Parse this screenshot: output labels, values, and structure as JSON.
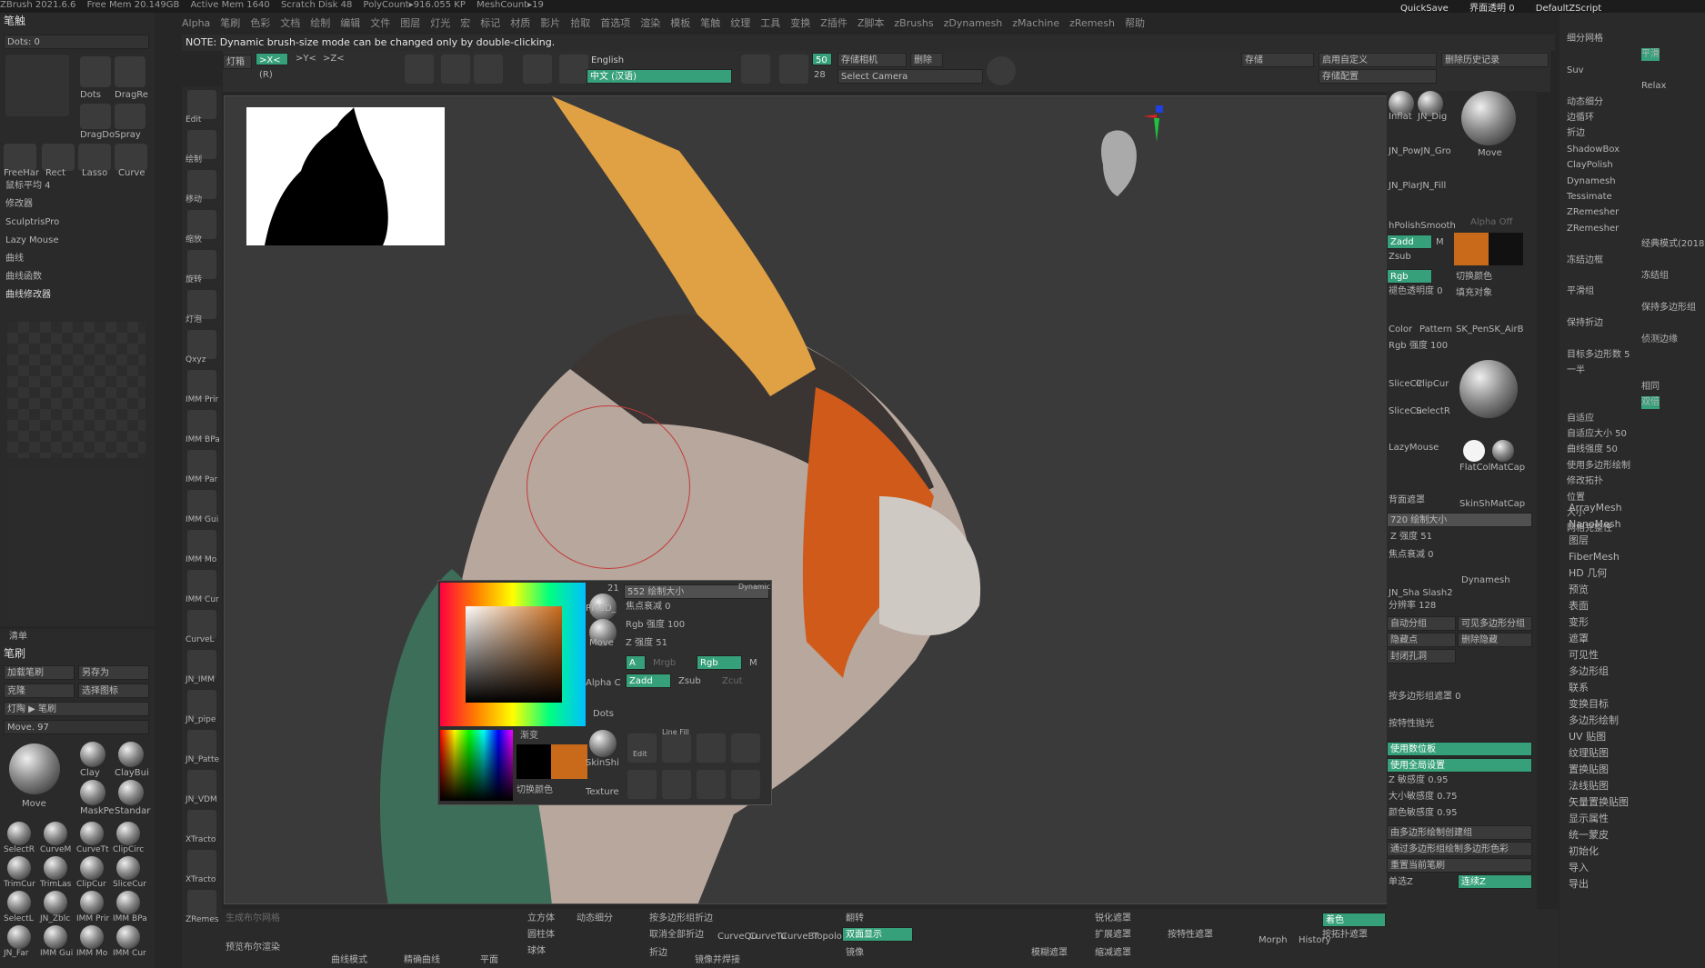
{
  "top_status": [
    "ZBrush 2021.6.6",
    "Free Mem 20.149GB",
    "Active Mem 1640",
    "Scratch Disk 48",
    "PolyCount▸916.055 KP",
    "MeshCount▸19"
  ],
  "top_right": [
    "QuickSave",
    "界面透明 0",
    "DefaultZScript"
  ],
  "menus": [
    "Alpha",
    "笔刷",
    "色彩",
    "文档",
    "绘制",
    "编辑",
    "文件",
    "图层",
    "灯光",
    "宏",
    "标记",
    "材质",
    "影片",
    "拾取",
    "首选项",
    "渲染",
    "模板",
    "笔触",
    "纹理",
    "工具",
    "变换",
    "Z插件",
    "Z脚本",
    "zBrushs",
    "zDynamesh",
    "zMachine",
    "zRemesh",
    "帮助"
  ],
  "note": "NOTE: Dynamic brush-size mode can be changed only by double-clicking.",
  "left_panel": {
    "title": "笔触",
    "dots": "Dots: 0",
    "r": "R",
    "strokes": [
      "Dots",
      "DragRe",
      "DragDo",
      "Spray",
      "FreeHar",
      "Rect",
      "Lasso",
      "Curve"
    ],
    "labels": [
      "鼠标平均 4",
      "修改器",
      "SculptrisPro",
      "Lazy Mouse",
      "曲线",
      "曲线函数",
      "曲线修改器"
    ],
    "bottom": [
      "清单",
      "笔刷"
    ],
    "brush_buttons": [
      "加载笔刷",
      "另存为",
      "克隆",
      "选择图标",
      "灯陶 ▶ 笔刷"
    ],
    "move": "Move. 97",
    "brushes": [
      "Move",
      "Clay",
      "ClayBui",
      "MaskPe",
      "Standar",
      "SelectR",
      "CurveM",
      "CurveTt",
      "ClipCirc",
      "TrimCur",
      "TrimLas",
      "ClipCur",
      "SliceCur",
      "SelectL",
      "JN_Zblc",
      "IMM Prir",
      "IMM BPa",
      "JN_Far",
      "IMM Gui",
      "IMM Mo",
      "IMM Cur"
    ]
  },
  "shelf": {
    "labels": [
      "Edit",
      "绘制",
      "移动",
      "缩放",
      "旋转",
      "灯泡",
      "Qxyz",
      "IMM Prir",
      "IMM BPa",
      "IMM Par",
      "IMM Gui",
      "IMM Mo",
      "IMM Cur",
      "CurveL",
      "JN_IMM",
      "JN_pipe",
      "JN_Patte",
      "JN_VDM",
      "XTracto",
      "XTracto",
      "ZRemes"
    ]
  },
  "toolbar": {
    "xyz": [
      ">X<",
      ">Y<",
      ">Z<"
    ],
    "r": "(R)",
    "light": "灯箱",
    "english": "English",
    "chinese": "中文 (汉语)",
    "fps": "50",
    "num28": "28",
    "cam": "存储相机",
    "del": "删除",
    "select_cam": "Select Camera",
    "store": "存储",
    "custom": "启用自定义",
    "store_cfg": "存储配置",
    "clear_history": "删除历史记录"
  },
  "popup": {
    "size": "552 绘制大小",
    "focal": "焦点衰减 0",
    "rgb": "Rgb 强度 100",
    "z": "Z 强度 51",
    "a": "A",
    "mrgb": "Mrgb",
    "rgb2": "Rgb",
    "m": "M",
    "zadd": "Zadd",
    "zsub": "Zsub",
    "zcut": "Zcut",
    "gradient": "渐变",
    "switch": "切换颜色",
    "num21": "21",
    "pm": "PM3D_",
    "move": "Move",
    "alpha": "Alpha C",
    "dots": "Dots",
    "skin": "SkinShi",
    "texture": "Texture",
    "edit": "Edit",
    "linefill": "Line Fill",
    "dynamic": "Dynamic"
  },
  "right_panel": {
    "brushes": [
      "Inflat",
      "JN_Dig",
      "JN_PowJN_Gro",
      "JN_PlarJN_Fill",
      "hPolishSmooth",
      "Move",
      "Alpha Off"
    ],
    "zadd": "Zadd",
    "m": "M",
    "zsub": "Zsub",
    "rgb": "Rgb",
    "switch_color": "切换颜色",
    "opacity": "褪色透明度 0",
    "fill": "填充对象",
    "mat": [
      "Color",
      "Pattern",
      "SK_Pen",
      "SK_AirB"
    ],
    "rgb_int": "Rgb 强度 100",
    "slice": [
      "SliceCir",
      "ClipCur",
      "SliceCu",
      "SelectR"
    ],
    "lazy": "LazyMouse",
    "flat": "FlatCol",
    "matcap": "MatCap",
    "skin": "SkinSh",
    "matcap2": "MatCap",
    "bg_mask": "背面遮罩",
    "size": "720 绘制大小",
    "z": "Z 强度 51",
    "focal": "焦点衰减 0",
    "jn": "JN_Sha Slash2",
    "dyn": "Dynamesh",
    "res": "分辨率 128",
    "grp": "自动分组",
    "vis": "可见多边形分组",
    "hide": "隐藏点",
    "delhide": "删除隐藏",
    "close": "封闭孔洞",
    "mask_grp": "按多边形组遮罩 0",
    "outline": "按特性抛光",
    "tablet": "使用数位板",
    "global": "使用全局设置",
    "zsens": "Z 敏感度 0.95",
    "sizesens": "大小敏感度 0.75",
    "colorsens": "颜色敏感度 0.95",
    "create_grp": "由多边形绘制创建组",
    "poly_color": "通过多边形组绘制多边形色彩",
    "reset_brush": "重置当前笔刷",
    "single": "单选Z",
    "continuous": "连续Z"
  },
  "far_right": {
    "top": [
      "细分网格",
      "平滑",
      "Suv",
      "Relax",
      "动态细分",
      "边循环",
      "折边",
      "ShadowBox",
      "ClayPolish",
      "Dynamesh",
      "Tessimate",
      "ZRemesher",
      "ZRemesher",
      "经典模式(2018)",
      "冻结边框",
      "冻结组",
      "平滑组",
      "保持多边形组",
      "保持折边",
      "侦测边缘",
      "目标多边形数 5",
      "一半",
      "相同",
      "双倍",
      "自适应",
      "自适应大小 50",
      "曲线强度 50",
      "使用多边形绘制",
      "修改拓扑",
      "位置",
      "大小",
      "网格完整性"
    ],
    "list": [
      "ArrayMesh",
      "NanoMesh",
      "图层",
      "FiberMesh",
      "HD 几何",
      "预览",
      "表面",
      "变形",
      "遮罩",
      "可见性",
      "多边形组",
      "联系",
      "变换目标",
      "多边形绘制",
      "UV 贴图",
      "纹理贴图",
      "置换贴图",
      "法线贴图",
      "矢量置换贴图",
      "显示属性",
      "统一蒙皮",
      "初始化",
      "导入",
      "导出"
    ]
  },
  "bottom": {
    "left": [
      "预览布尔渲染",
      "生成布尔网格",
      "曲线模式",
      "精确曲线"
    ],
    "mid": [
      "立方体",
      "圆柱体",
      "球体",
      "平面",
      "动态细分",
      "按多边形组折边",
      "取消全部折边",
      "折边",
      "CurveQu",
      "CurveTu",
      "CurveBr",
      "Topolog",
      "翻转",
      "双面显示",
      "镜像",
      "镜像并焊接"
    ],
    "right": [
      "Morph",
      "History",
      "着色",
      "锐化遮罩",
      "扩展遮罩",
      "模糊遮罩",
      "缩减遮罩",
      "按特性遮罩",
      "按拓扑遮罩"
    ]
  },
  "colors": {
    "accent": "#36a07a",
    "orange": "#c86a1a",
    "bg": "#262626",
    "panel": "#2a2a2a"
  }
}
